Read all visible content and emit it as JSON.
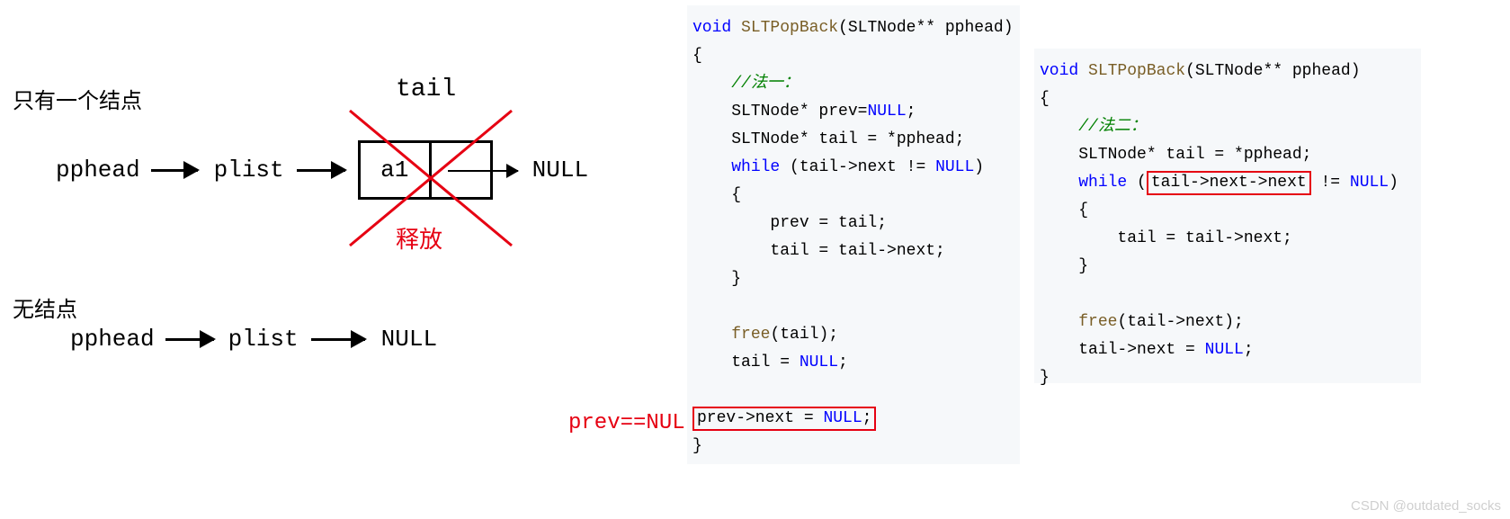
{
  "diagram": {
    "title_one_node": "只有一个结点",
    "title_no_node": "无结点",
    "tail_label": "tail",
    "release_label": "释放",
    "pphead": "pphead",
    "plist": "plist",
    "node_data": "a1",
    "null_text": "NULL",
    "prev_eq": "prev==NULL"
  },
  "code1": {
    "l1_kw": "void",
    "l1_fn": "SLTPopBack",
    "l1_rest": "(SLTNode** pphead)",
    "l2": "{",
    "l3_cm": "//法一：",
    "l4a": "    SLTNode* prev=",
    "l4b": "NULL",
    "l4c": ";",
    "l5": "    SLTNode* tail = *pphead;",
    "l6a": "    ",
    "l6_kw": "while",
    "l6b": " (tail->next != ",
    "l6_lit": "NULL",
    "l6c": ")",
    "l7": "    {",
    "l8": "        prev = tail;",
    "l9": "        tail = tail->next;",
    "l10": "    }",
    "blank": "",
    "l11a": "    ",
    "l11_fn": "free",
    "l11b": "(tail);",
    "l12a": "    tail = ",
    "l12_lit": "NULL",
    "l12b": ";",
    "l13a": "prev->next = ",
    "l13_lit": "NULL",
    "l13b": ";",
    "l14": "}"
  },
  "code2": {
    "l1_kw": "void",
    "l1_fn": "SLTPopBack",
    "l1_rest": "(SLTNode** pphead)",
    "l2": "{",
    "l3_cm": "//法二：",
    "l4": "    SLTNode* tail = *pphead;",
    "l5a": "    ",
    "l5_kw": "while",
    "l5b": " (",
    "l5_box": "tail->next->next",
    "l5c": " != ",
    "l5_lit": "NULL",
    "l5d": ")",
    "l6": "    {",
    "l7": "        tail = tail->next;",
    "l8": "    }",
    "blank": "",
    "l9a": "    ",
    "l9_fn": "free",
    "l9b": "(tail->next);",
    "l10a": "    tail->next = ",
    "l10_lit": "NULL",
    "l10b": ";",
    "l11": "}"
  },
  "watermark": "CSDN @outdated_socks"
}
